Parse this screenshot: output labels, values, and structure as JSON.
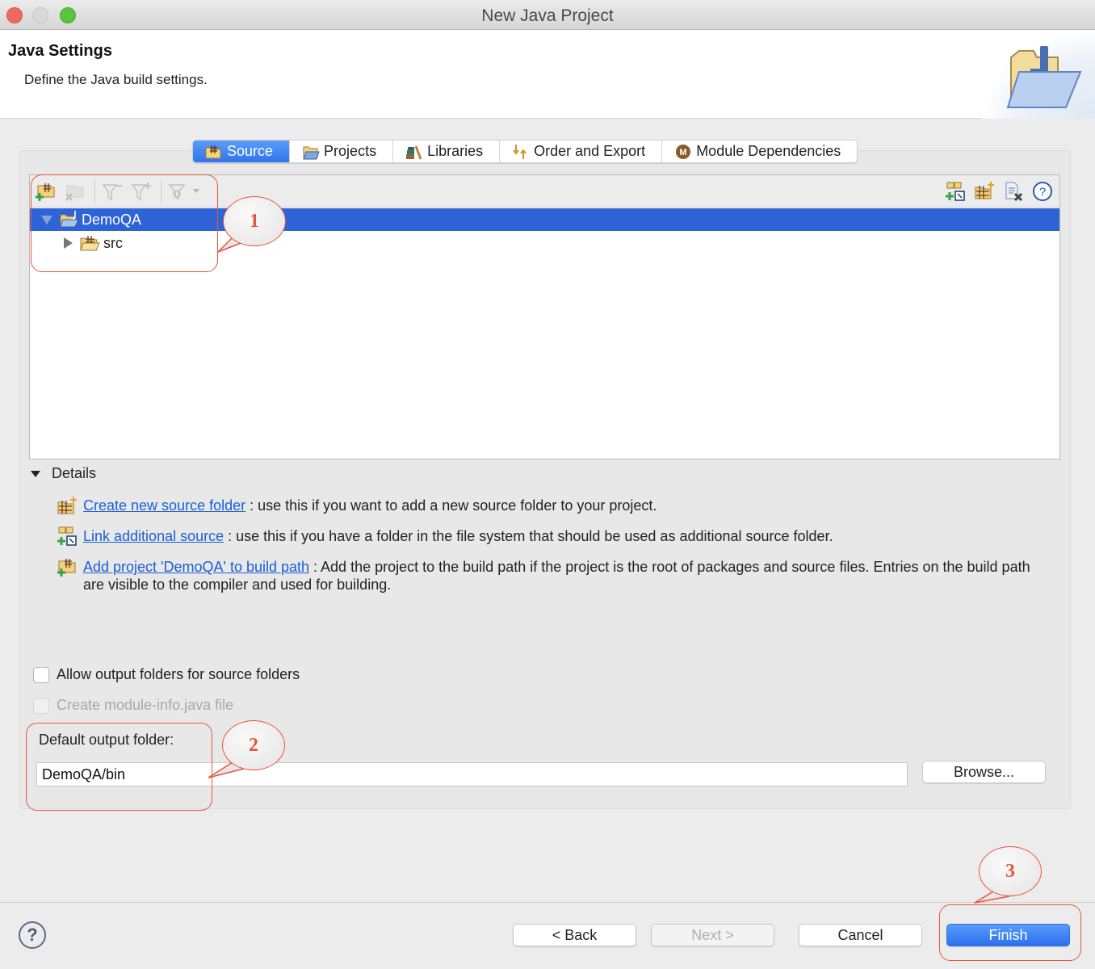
{
  "window": {
    "title": "New Java Project",
    "traffic_lights": [
      "close",
      "minimize",
      "maximize"
    ]
  },
  "header": {
    "title": "Java Settings",
    "description": "Define the Java build settings.",
    "icon": "folder-wizard-icon"
  },
  "tabs": [
    {
      "label": "Source",
      "icon": "source-folder-icon",
      "active": true
    },
    {
      "label": "Projects",
      "icon": "projects-icon",
      "active": false
    },
    {
      "label": "Libraries",
      "icon": "libraries-icon",
      "active": false
    },
    {
      "label": "Order and Export",
      "icon": "order-export-icon",
      "active": false
    },
    {
      "label": "Module Dependencies",
      "icon": "module-icon",
      "active": false
    }
  ],
  "tree_toolbar": {
    "left": [
      "add-source-folder-icon",
      "remove-source-folder-icon",
      "exclusion-filter-icon",
      "inclusion-filter-icon",
      "configure-icon"
    ],
    "right": [
      "link-source-icon",
      "create-source-folder-icon",
      "remove-entry-icon",
      "help-icon"
    ]
  },
  "tree": {
    "items": [
      {
        "label": "DemoQA",
        "expanded": true,
        "selected": true,
        "icon": "java-project-icon"
      },
      {
        "label": "src",
        "expanded": false,
        "selected": false,
        "icon": "package-folder-icon"
      }
    ]
  },
  "details": {
    "label": "Details",
    "expanded": true,
    "rows": [
      {
        "link": "Create new source folder",
        "text": " : use this if you want to add a new source folder to your project."
      },
      {
        "link": "Link additional source",
        "text": " : use this if you have a folder in the file system that should be used as additional source folder."
      },
      {
        "link": "Add project 'DemoQA' to build path",
        "text": " : Add the project to the build path if the project is the root of packages and source files. Entries on the build path are visible to the compiler and used for building."
      }
    ]
  },
  "options": {
    "allow_output_folders": {
      "label": "Allow output folders for source folders",
      "checked": false,
      "enabled": true
    },
    "create_module_info": {
      "label": "Create module-info.java file",
      "checked": false,
      "enabled": false
    }
  },
  "output": {
    "label": "Default output folder:",
    "value": "DemoQA/bin",
    "browse_label": "Browse..."
  },
  "footer": {
    "back_label": "< Back",
    "next_label": "Next >",
    "cancel_label": "Cancel",
    "finish_label": "Finish",
    "help": "?"
  },
  "annotations": [
    "1",
    "2",
    "3"
  ],
  "colors": {
    "accent": "#2f74ee",
    "selection": "#2f64d8",
    "link": "#1a5fd8",
    "annotation": "#e8553e"
  }
}
